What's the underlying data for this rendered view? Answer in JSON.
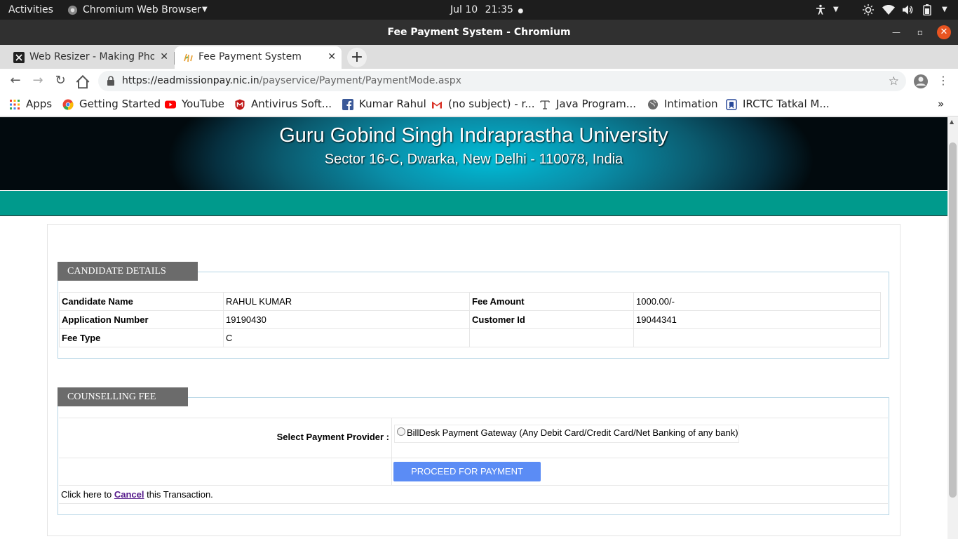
{
  "system_bar": {
    "activities": "Activities",
    "app_name": "Chromium Web Browser",
    "date": "Jul 10",
    "time": "21:35"
  },
  "window": {
    "title": "Fee Payment System - Chromium"
  },
  "tabs": [
    {
      "title": "Web Resizer - Making Pho",
      "active": false
    },
    {
      "title": "Fee Payment System",
      "active": true
    }
  ],
  "address_bar": {
    "url_host": "https://eadmissionpay.nic.in",
    "url_path": "/payservice/Payment/PaymentMode.aspx"
  },
  "bookmarks": [
    {
      "label": "Apps",
      "icon": "apps-grid-icon"
    },
    {
      "label": "Getting Started",
      "icon": "chrome-icon"
    },
    {
      "label": "YouTube",
      "icon": "youtube-icon"
    },
    {
      "label": "Antivirus Soft...",
      "icon": "mcafee-icon"
    },
    {
      "label": "Kumar Rahul",
      "icon": "facebook-icon"
    },
    {
      "label": "(no subject) - r...",
      "icon": "gmail-icon"
    },
    {
      "label": "Java Program...",
      "icon": "text-icon"
    },
    {
      "label": "Intimation",
      "icon": "globe-icon"
    },
    {
      "label": "IRCTC Tatkal M...",
      "icon": "irctc-icon"
    }
  ],
  "header": {
    "university": "Guru Gobind Singh Indraprastha University",
    "address": "Sector 16-C, Dwarka, New Delhi - 110078, India"
  },
  "candidate_details": {
    "legend": "CANDIDATE DETAILS",
    "rows": [
      [
        "Candidate Name",
        "RAHUL KUMAR",
        "Fee Amount",
        "1000.00/-"
      ],
      [
        "Application Number",
        "19190430",
        "Customer Id",
        "19044341"
      ],
      [
        "Fee Type",
        "C",
        "",
        ""
      ]
    ]
  },
  "counselling_fee": {
    "legend": "COUNSELLING FEE",
    "provider_label": "Select Payment Provider :",
    "provider_option": "BillDesk Payment Gateway (Any Debit Card/Credit Card/Net Banking of any bank)",
    "proceed_button": "PROCEED FOR PAYMENT",
    "cancel_prefix": "Click here to",
    "cancel_link": "Cancel",
    "cancel_suffix": "this Transaction."
  }
}
